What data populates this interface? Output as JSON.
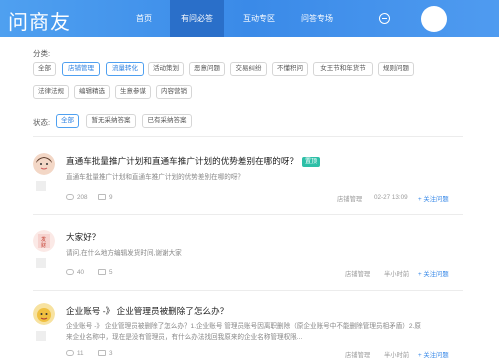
{
  "header": {
    "logo": "问商友",
    "nav": [
      {
        "label": "首页"
      },
      {
        "label": "有问必答"
      },
      {
        "label": "互动专区"
      },
      {
        "label": "问答专场"
      }
    ],
    "active_nav": 1
  },
  "filters": {
    "category_label": "分类:",
    "categories": [
      "全部",
      "店铺管理",
      "流量转化",
      "活动策划",
      "恶意问题",
      "交易纠纷",
      "不懂积问",
      "女王节和年货节",
      "规则问题",
      "法律法规",
      "编辑精选",
      "生意参谋",
      "内容营销"
    ],
    "active_categories": [
      1,
      2
    ],
    "status_label": "状态:",
    "statuses": [
      "全部",
      "暂无采纳答案",
      "已有采纳答案"
    ],
    "active_status": 0
  },
  "questions": [
    {
      "title": "直通车批量推广计划和直通车推广计划的优势差别在哪的呀？",
      "badge": "置顶",
      "body": "直通车批量推广计划和直通车推广计划的优势差别在哪的呀？",
      "views": "208",
      "comments": "9",
      "category": "店铺管理",
      "time": "02-27 13:09",
      "follow": "+ 关注问题"
    },
    {
      "title": "大家好？",
      "body": "请问,在什么地方编辑发货时间,谢谢大家",
      "views": "40",
      "comments": "5",
      "category": "店铺管理",
      "time": "半小时前",
      "follow": "+ 关注问题"
    },
    {
      "title": "企业账号 -》 企业管理员被删除了怎么办？",
      "body_lines": [
        "企业账号 -》 企业管理员被删除了怎么办？1.企业账号 管理员账号因离职删除（原企业账号中不能删除管理员相矛盾）2.原",
        "来企业名称中，现在是没有管理员，有什么办法找回我原来的企业名称管理权限..."
      ],
      "views": "11",
      "comments": "3",
      "category": "店铺管理",
      "time": "半小时前",
      "follow": "+ 关注问题"
    }
  ],
  "colors": {
    "header": "#3a8ae8",
    "accent": "#4fa0f0",
    "badge": "#2dbfa7"
  }
}
